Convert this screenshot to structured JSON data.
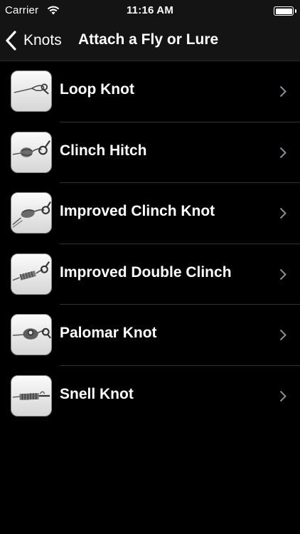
{
  "status_bar": {
    "carrier": "Carrier",
    "time": "11:16 AM"
  },
  "nav": {
    "back_label": "Knots",
    "title": "Attach a Fly or Lure"
  },
  "items": [
    {
      "label": "Loop Knot",
      "icon": "loop-knot-icon"
    },
    {
      "label": "Clinch Hitch",
      "icon": "clinch-hitch-icon"
    },
    {
      "label": "Improved Clinch Knot",
      "icon": "improved-clinch-knot-icon"
    },
    {
      "label": "Improved Double Clinch",
      "icon": "improved-double-clinch-icon"
    },
    {
      "label": "Palomar Knot",
      "icon": "palomar-knot-icon"
    },
    {
      "label": "Snell Knot",
      "icon": "snell-knot-icon"
    }
  ],
  "colors": {
    "background": "#000000",
    "bar": "#141414",
    "separator": "#333333",
    "text": "#ffffff",
    "chevron": "#8e8e93"
  }
}
